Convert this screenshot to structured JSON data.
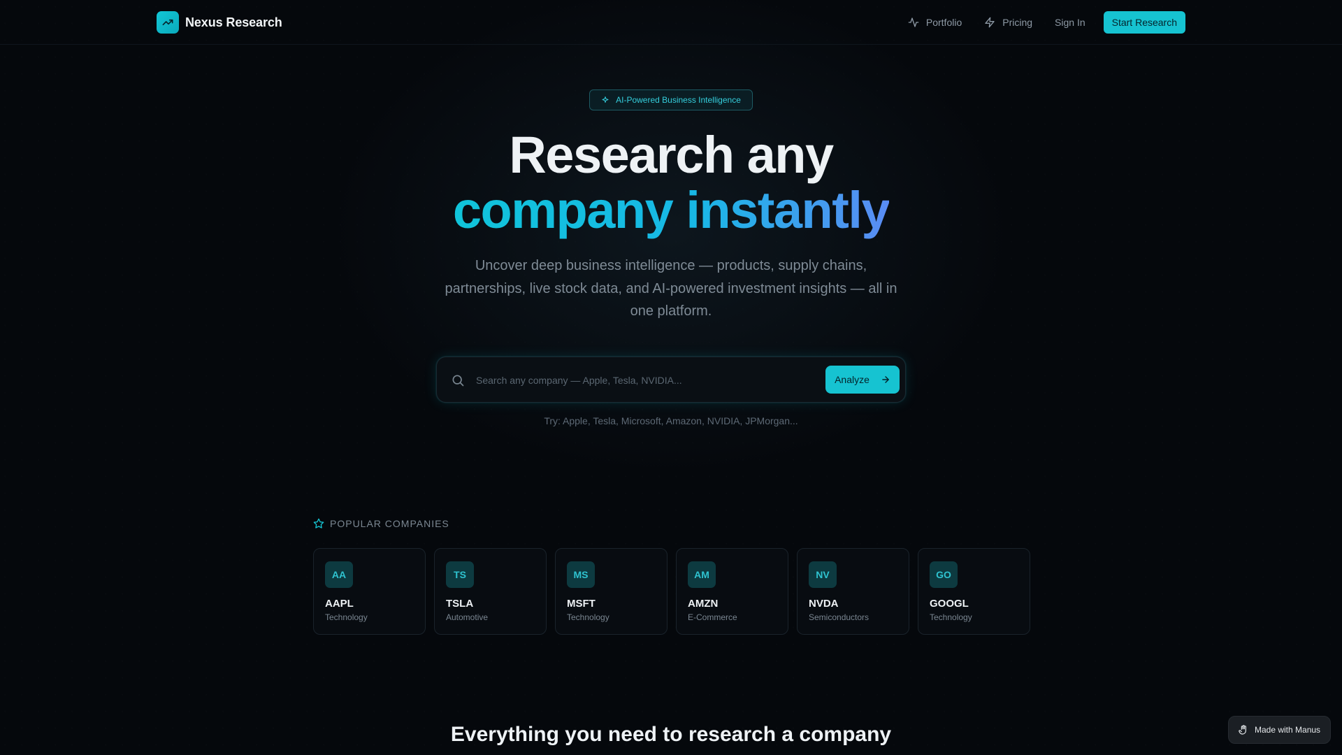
{
  "brand": {
    "name": "Nexus Research",
    "logo_icon": "trending-up-icon"
  },
  "nav": {
    "links": [
      {
        "label": "Portfolio",
        "icon": "activity-icon"
      },
      {
        "label": "Pricing",
        "icon": "zap-icon"
      },
      {
        "label": "Sign In"
      }
    ],
    "cta_label": "Start Research"
  },
  "hero": {
    "pill_label": "AI-Powered Business Intelligence",
    "title_line1": "Research any",
    "title_line2": "company instantly",
    "subtitle": "Uncover deep business intelligence — products, supply chains, partnerships, live stock data, and AI-powered investment insights — all in one platform."
  },
  "search": {
    "placeholder": "Search any company — Apple, Tesla, NVIDIA...",
    "value": "",
    "button_label": "Analyze",
    "suggestions": "Try: Apple, Tesla, Microsoft, Amazon, NVIDIA, JPMorgan..."
  },
  "popular": {
    "heading": "POPULAR COMPANIES",
    "companies": [
      {
        "initials": "AA",
        "ticker": "AAPL",
        "sector": "Technology"
      },
      {
        "initials": "TS",
        "ticker": "TSLA",
        "sector": "Automotive"
      },
      {
        "initials": "MS",
        "ticker": "MSFT",
        "sector": "Technology"
      },
      {
        "initials": "AM",
        "ticker": "AMZN",
        "sector": "E-Commerce"
      },
      {
        "initials": "NV",
        "ticker": "NVDA",
        "sector": "Semiconductors"
      },
      {
        "initials": "GO",
        "ticker": "GOOGL",
        "sector": "Technology"
      }
    ]
  },
  "features": {
    "heading": "Everything you need to research a company"
  },
  "badge": {
    "label": "Made with Manus"
  },
  "colors": {
    "accent": "#16c3d1",
    "background": "#05080c",
    "gradient_end": "#5a8cf4"
  }
}
